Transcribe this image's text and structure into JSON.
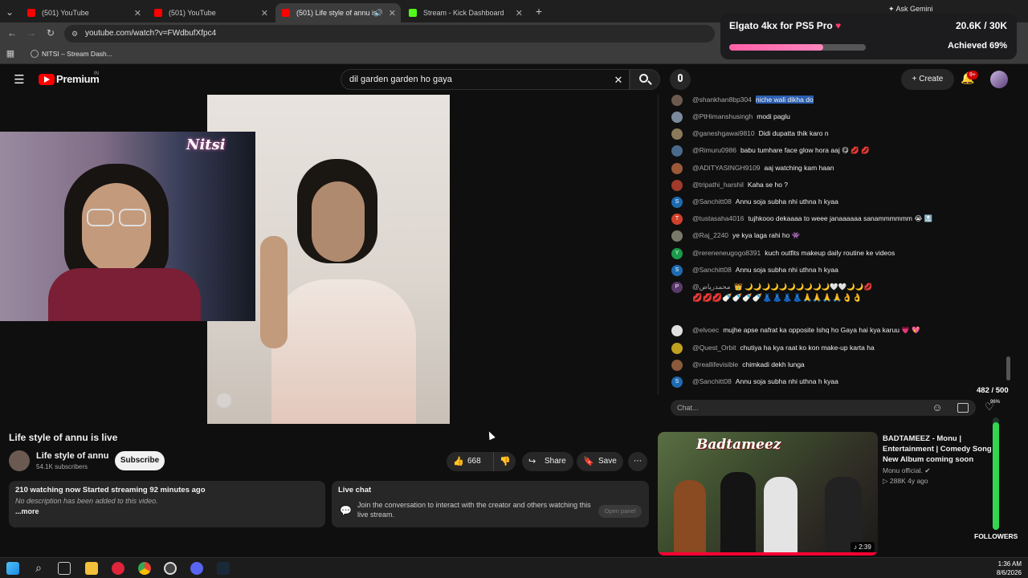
{
  "browser": {
    "tabs": [
      {
        "title": "(501) YouTube"
      },
      {
        "title": "(501) YouTube"
      },
      {
        "title": "(501) Life style of annu is live"
      },
      {
        "title": "Stream - Kick Dashboard"
      }
    ],
    "ask_gemini": "Ask Gemini",
    "url": "youtube.com/watch?v=FWdbufXfpc4",
    "bookmark": "NITSI – Stream Dash..."
  },
  "youtube": {
    "logo_text": "Premium",
    "logo_region": "IN",
    "search_query": "dil garden garden ho gaya",
    "create_label": "Create",
    "notif_count": "9+"
  },
  "overlay": {
    "goal_title": "Elgato 4kx for PS5 Pro",
    "goal_count": "20.6K / 30K",
    "goal_status": "Achieved 69%",
    "goal_progress": 0.69,
    "stream_logo": "Nitsi",
    "followers_label": "FOLLOWERS",
    "followers_count": "482 / 500",
    "followers_pct": "96%",
    "followers_progress": 0.96
  },
  "video": {
    "title": "Life style of annu is live",
    "channel": "Life style of annu",
    "subscribers": "54.1K subscribers",
    "subscribe_label": "Subscribe",
    "likes": "668",
    "share_label": "Share",
    "save_label": "Save",
    "stats": "210 watching now  Started streaming 92 minutes ago",
    "description": "No description has been added to this video.",
    "more_label": "...more",
    "live_chat_heading": "Live chat",
    "live_chat_text": "Join the conversation to interact with the creator and others watching this live stream.",
    "open_panel": "Open panel"
  },
  "chat": {
    "input_placeholder": "Chat...",
    "messages": [
      {
        "author": "@shankhan8bp304",
        "text": "niche wali dikha do",
        "initial": "",
        "color": "#6d5a4e"
      },
      {
        "author": "@PtHimanshusingh",
        "text": "modi paglu",
        "initial": "",
        "color": "#7a8a9a"
      },
      {
        "author": "@ganeshgawai9810",
        "text": "Didi dupatta thik karo n",
        "initial": "",
        "color": "#8a7a5a"
      },
      {
        "author": "@Rimuru0986",
        "text": "babu tumhare face glow hora aaj 😋 💋 💋",
        "initial": "",
        "color": "#4a6a8a"
      },
      {
        "author": "@ADITYASINGH9109",
        "text": "aaj watching kam haan",
        "initial": "",
        "color": "#9a5a3a"
      },
      {
        "author": "@tripathi_harshil",
        "text": "Kaha se ho ?",
        "initial": "",
        "color": "#a03a2a"
      },
      {
        "author": "@Sanchitt08",
        "text": "Annu soja subha nhi uthna h kyaa",
        "initial": "S",
        "color": "#1e6ab0"
      },
      {
        "author": "@tustasaha4016",
        "text": "tujhkooo dekaaaa to weee janaaaaaa sanammmmmm 😭 🔝",
        "initial": "T",
        "color": "#d0402a"
      },
      {
        "author": "@Raj_2240",
        "text": "ye kya laga rahi ho 👾",
        "initial": "",
        "color": "#7a7a6a"
      },
      {
        "author": "@rereneneugogo8391",
        "text": "kuch outfits makeup daily routine ke videos",
        "initial": "Y",
        "color": "#1a9a4a"
      },
      {
        "author": "@Sanchitt08",
        "text": "Annu soja subha nhi uthna h kyaa",
        "initial": "S",
        "color": "#1e6ab0"
      },
      {
        "author": "@محمدرياض",
        "text": "👑 🌙🌙🌙🌙🌙🌙🌙🌙🌙🌙🤍🤍🌙🌙💋",
        "initial": "P",
        "color": "#5a3a6a"
      },
      {
        "author": "@elvoec",
        "text": "mujhe apse nafrat ka opposite Ishq ho Gaya hai kya karuu 💗 💖",
        "initial": "",
        "color": "#e0e0e0"
      },
      {
        "author": "@Quest_Orbit",
        "text": "chutiya ha kya raat ko kon make-up karta ha",
        "initial": "",
        "color": "#c0a020"
      },
      {
        "author": "@reallifevisible",
        "text": "chimkadi dekh lunga",
        "initial": "",
        "color": "#8a5a3a"
      },
      {
        "author": "@Sanchitt08",
        "text": "Annu soja subha nhi uthna h kyaa",
        "initial": "S",
        "color": "#1e6ab0"
      }
    ],
    "wrapped_emoji_line": "💋💋💋🍼🍼🍼🍼👗👗👗👗🙏🙏🙏🙏👌👌"
  },
  "recommendation": {
    "title": "BADTAMEEZ - Monu | Entertainment | Comedy Song | New Album coming soon",
    "thumb_text": "Badtameez",
    "channel": "Monu official.",
    "meta": "288K  4y ago",
    "duration": "2:39"
  },
  "taskbar": {
    "time": "1:36 AM",
    "date": "8/6/2026"
  }
}
